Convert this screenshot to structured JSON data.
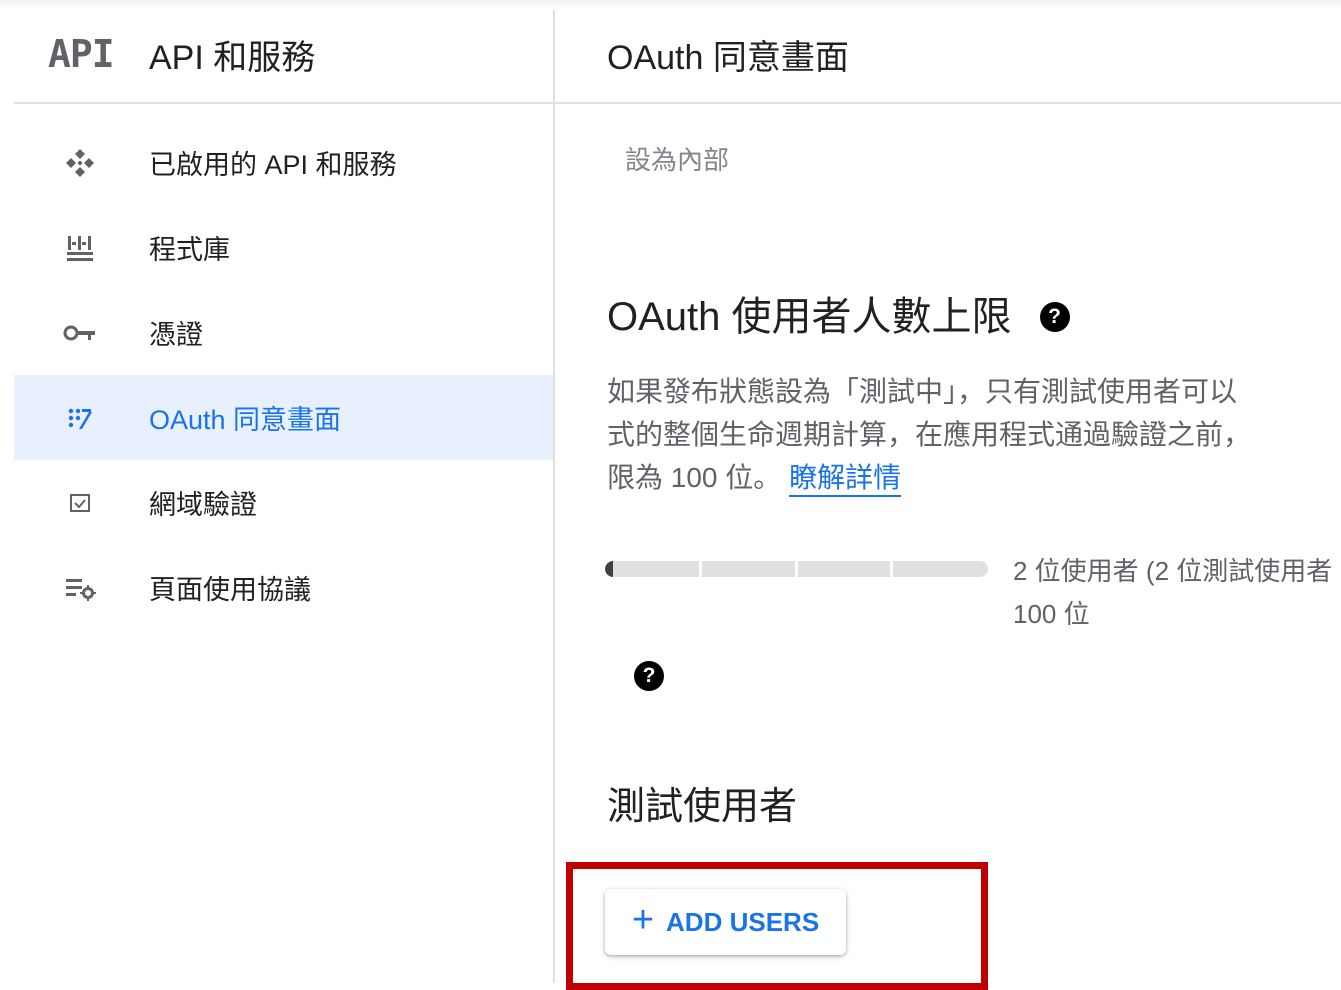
{
  "sidebar": {
    "logo": "API",
    "title": "API 和服務",
    "items": [
      {
        "label": "已啟用的 API 和服務",
        "icon": "enabled-apis-icon",
        "active": false
      },
      {
        "label": "程式庫",
        "icon": "library-icon",
        "active": false
      },
      {
        "label": "憑證",
        "icon": "key-icon",
        "active": false
      },
      {
        "label": "OAuth 同意畫面",
        "icon": "oauth-consent-icon",
        "active": true
      },
      {
        "label": "網域驗證",
        "icon": "domain-verification-icon",
        "active": false
      },
      {
        "label": "頁面使用協議",
        "icon": "page-usage-agreement-icon",
        "active": false
      }
    ]
  },
  "main": {
    "title": "OAuth 同意畫面",
    "set_internal": "設為內部",
    "user_cap": {
      "title": "OAuth 使用者人數上限",
      "description_lines": [
        "如果發布狀態設為「測試中」，只有測試使用者可以",
        "式的整個生命週期計算，在應用程式通過驗證之前，",
        "限為 100 位。"
      ],
      "learn_more": "瞭解詳情",
      "progress_fraction": 0.02,
      "progress_text_line1": "2 位使用者 (2 位測試使用者",
      "progress_text_line2": "100 位"
    },
    "test_users": {
      "title": "測試使用者",
      "add_button": "ADD USERS"
    }
  },
  "colors": {
    "accent": "#1a73e8",
    "active_bg": "#e8f0fe",
    "highlight": "#c00000"
  }
}
